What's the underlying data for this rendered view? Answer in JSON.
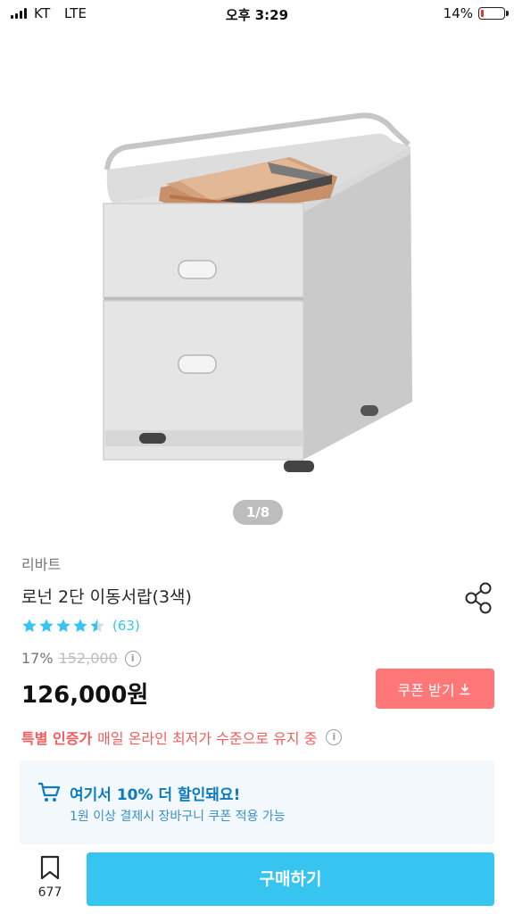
{
  "status_bar": {
    "carrier": "KT",
    "network": "LTE",
    "time": "오후 3:29",
    "battery": "14%",
    "battery_level": 0.14
  },
  "gallery": {
    "indicator": "1/8"
  },
  "product": {
    "brand": "리바트",
    "title": "로넌 2단 이동서랍(3색)",
    "rating_stars": 4.5,
    "review_count": "(63)",
    "discount_rate": "17%",
    "original_price": "152,000",
    "sale_price": "126,000원"
  },
  "coupon": {
    "label": "쿠폰 받기"
  },
  "certified": {
    "label": "특별 인증가",
    "text": "매일 온라인 최저가 수준으로 유지 중"
  },
  "discount_box": {
    "title": "여기서 10% 더 할인돼요!",
    "description": "1원 이상 결제시 장바구니 쿠폰 적용 가능"
  },
  "bottom_bar": {
    "bookmark_count": "677",
    "buy_label": "구매하기"
  },
  "colors": {
    "accent": "#35c5f0",
    "coupon": "#ff7777",
    "certified": "#f25d5d",
    "discount_text": "#0b7cc0",
    "discount_bg": "#f2f8fc"
  },
  "icons": [
    "share-icon",
    "star-icon",
    "info-icon",
    "download-icon",
    "cart-icon",
    "bookmark-icon"
  ]
}
